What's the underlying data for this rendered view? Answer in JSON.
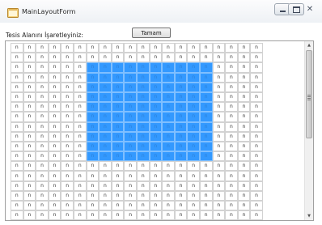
{
  "window": {
    "title": "MainLayoutForm",
    "close_glyph": "✕",
    "icons": {
      "app": "form-app-icon",
      "minimize": "minimize-icon",
      "maximize": "maximize-icon",
      "close": "close-icon"
    }
  },
  "toolbar": {
    "prompt": "Tesis Alanını İşaretleyiniz:",
    "ok_label": "Tamam"
  },
  "grid": {
    "rows": 18,
    "cols": 20,
    "cell_text": "n",
    "selected_rows": [
      2,
      11
    ],
    "selected_cols": [
      6,
      15
    ],
    "selection_color": "#3399ff"
  },
  "scrollbar": {
    "up_glyph": "▲",
    "down_glyph": "▼",
    "thumb_fraction": 0.55
  }
}
